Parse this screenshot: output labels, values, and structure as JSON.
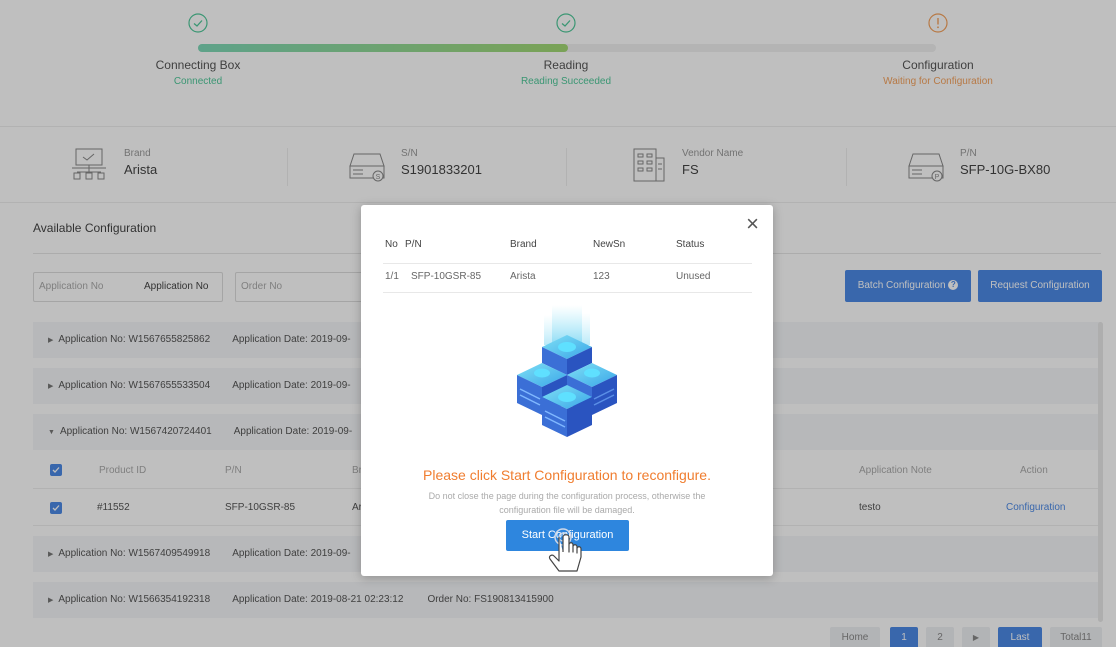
{
  "steps": [
    {
      "title": "Connecting Box",
      "sub": "Connected",
      "state": "done"
    },
    {
      "title": "Reading",
      "sub": "Reading Succeeded",
      "state": "done"
    },
    {
      "title": "Configuration",
      "sub": "Waiting for Configuration",
      "state": "pending"
    }
  ],
  "colors": {
    "done": "#4fc99a",
    "pending": "#f5a25d",
    "accent": "#4d8ae6",
    "modal_button": "#2e86de",
    "warning_text": "#f07d2f"
  },
  "progress": {
    "percent": 50
  },
  "device": {
    "brand_label": "Brand",
    "brand": "Arista",
    "sn_label": "S/N",
    "sn": "S1901833201",
    "vendor_label": "Vendor Name",
    "vendor": "FS",
    "pn_label": "P/N",
    "pn": "SFP-10G-BX80"
  },
  "available": {
    "title": "Available Configuration",
    "filter_app_placeholder": "Application No",
    "filter_app_value": "Application No",
    "filter_order_placeholder": "Order No",
    "batch_label": "Batch Configuration",
    "request_label": "Request Configuration"
  },
  "apps": [
    {
      "label": "Application No:",
      "no": "W1567655825862",
      "date_label": "Application Date:",
      "date": "2019-09-",
      "expanded": false
    },
    {
      "label": "Application No:",
      "no": "W1567655533504",
      "date_label": "Application Date:",
      "date": "2019-09-",
      "expanded": false
    },
    {
      "label": "Application No:",
      "no": "W1567420724401",
      "date_label": "Application Date:",
      "date": "2019-09-",
      "expanded": true
    },
    {
      "label": "Application No:",
      "no": "W1567409549918",
      "date_label": "Application Date:",
      "date": "2019-09-",
      "expanded": false
    },
    {
      "label": "Application No:",
      "no": "W1566354192318",
      "date_label": "Application Date:",
      "date": "2019-08-21 02:23:12",
      "order_label": "Order No:",
      "order": "FS190813415900",
      "expanded": false
    }
  ],
  "table": {
    "headers": {
      "product": "Product ID",
      "pn": "P/N",
      "brand": "Br",
      "note": "Application Note",
      "action": "Action"
    },
    "row": {
      "product": "#11552",
      "pn": "SFP-10GSR-85",
      "brand": "Ar",
      "note": "testo",
      "action": "Configuration"
    }
  },
  "pagination": {
    "home": "Home",
    "p1": "1",
    "p2": "2",
    "next": "▶",
    "last": "Last",
    "total": "Total11"
  },
  "modal": {
    "headers": {
      "no": "No",
      "pn": "P/N",
      "brand": "Brand",
      "newsn": "NewSn",
      "status": "Status"
    },
    "row": {
      "no": "1/1",
      "pn": "SFP-10GSR-85",
      "brand": "Arista",
      "newsn": "123",
      "status": "Unused"
    },
    "message": "Please click Start Configuration to reconfigure.",
    "note": "Do not close the page during the configuration process, otherwise the configuration file will be damaged.",
    "button": "Start Configuration",
    "close": "×"
  }
}
